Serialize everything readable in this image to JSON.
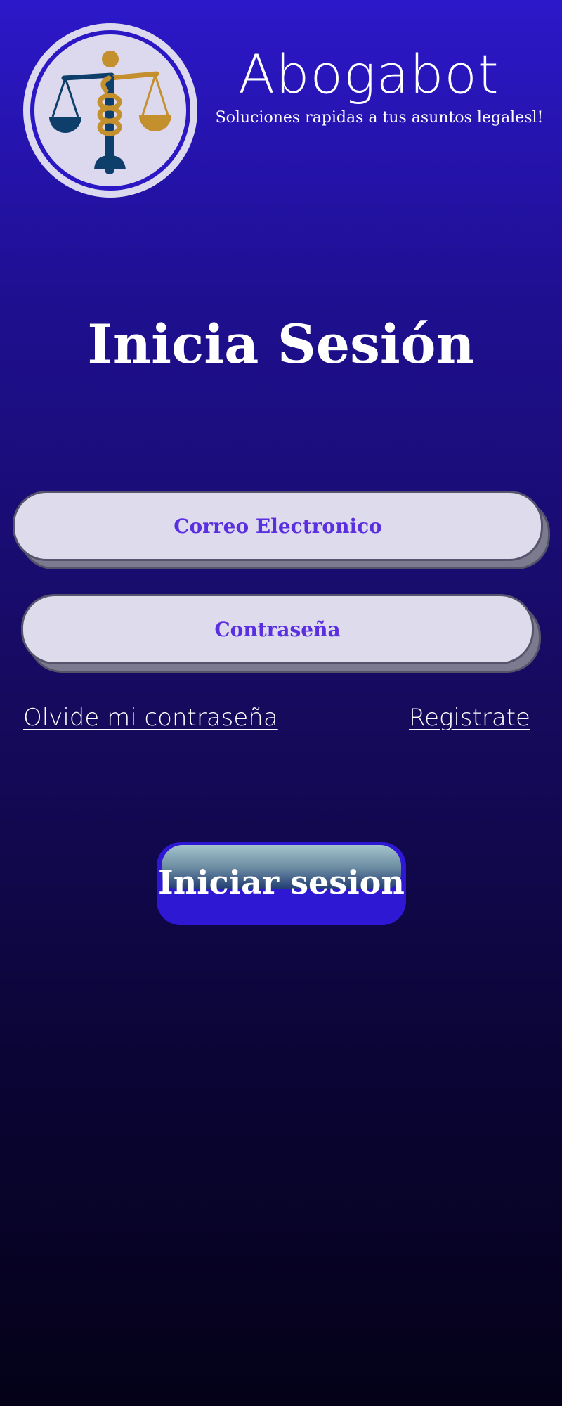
{
  "brand": {
    "logo_icon": "scales-of-justice-icon",
    "title": "Abogabot",
    "tagline": "Soluciones rapidas a tus asuntos legalesl!"
  },
  "login": {
    "heading": "Inicia Sesión",
    "email_placeholder": "Correo Electronico",
    "password_placeholder": "Contraseña",
    "forgot_link": "Olvide mi contraseña",
    "register_link": "Registrate",
    "submit_label": "Iniciar sesion"
  },
  "colors": {
    "background_top": "#2c18c9",
    "background_bottom": "#040118",
    "field_fill": "#dedcec",
    "field_text": "#5a2fe0",
    "button_fill": "#2e18d4",
    "logo_navy": "#0e3f6a",
    "logo_gold": "#c4902e"
  }
}
